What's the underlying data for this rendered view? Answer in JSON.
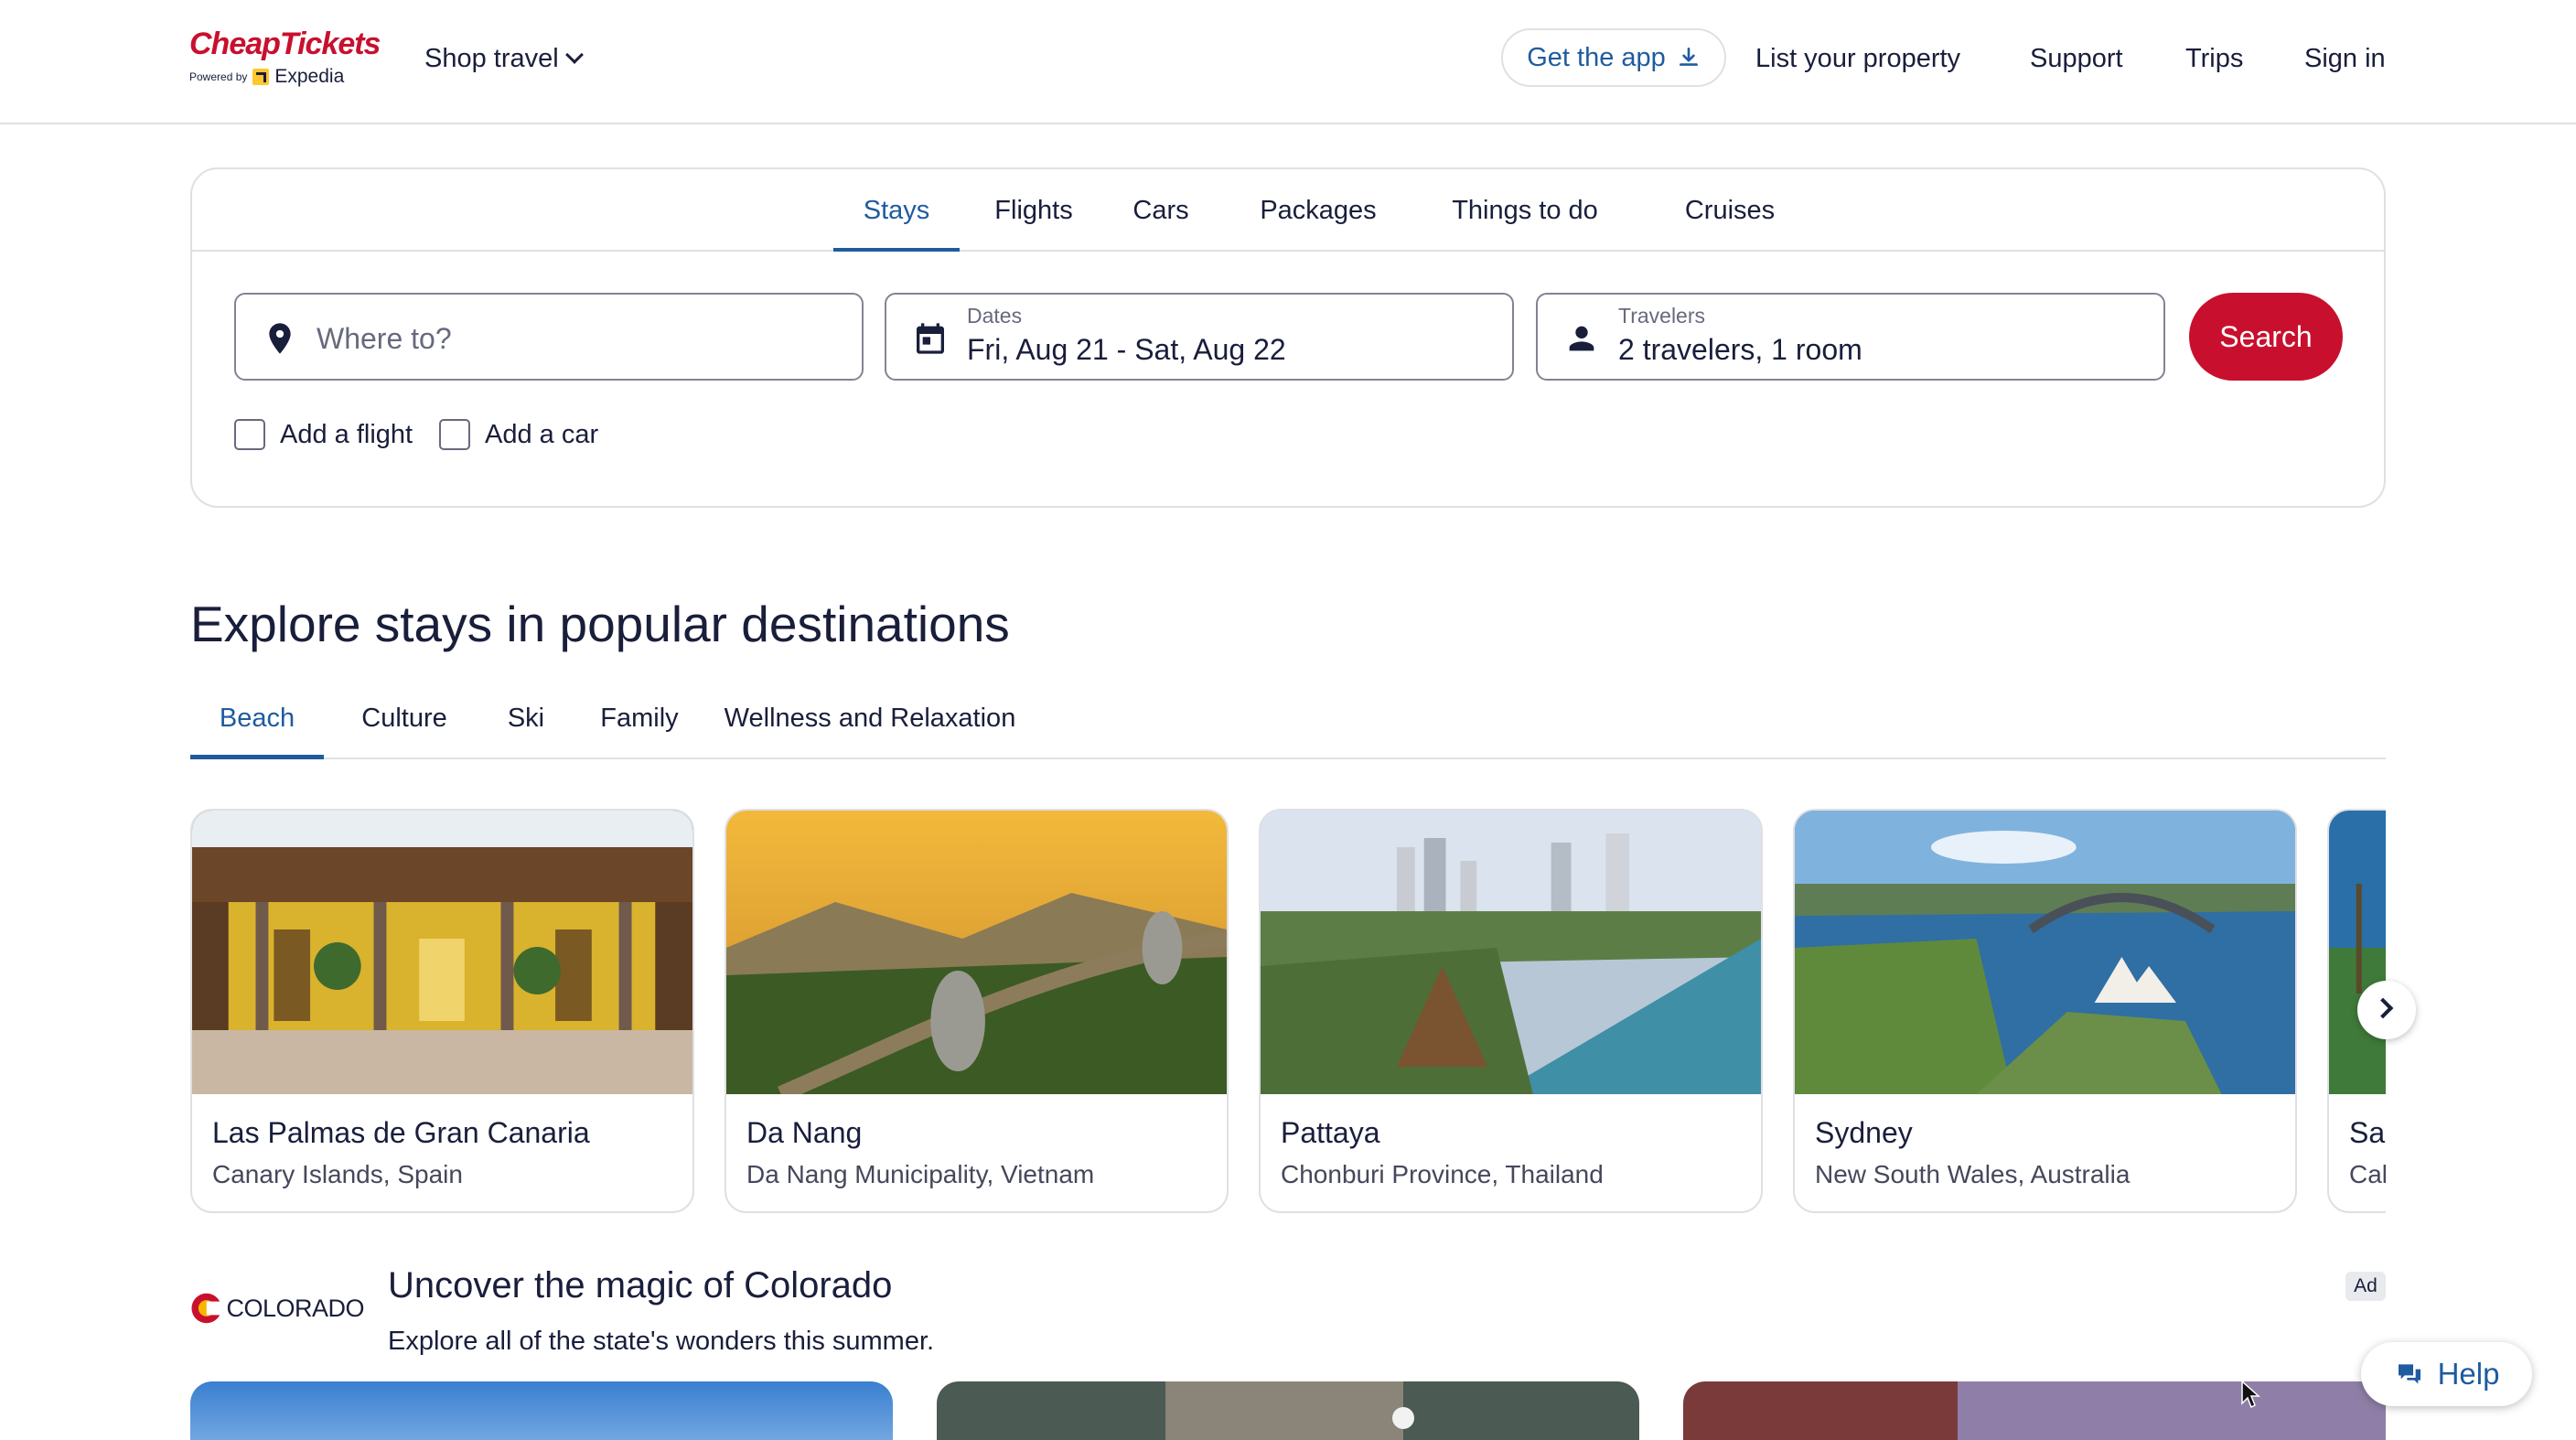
{
  "header": {
    "logo_text": "CheapTickets",
    "logo_powered": "Powered by",
    "logo_partner": "Expedia",
    "shop_travel": "Shop travel",
    "get_app": "Get the app",
    "list_property": "List your property",
    "support": "Support",
    "trips": "Trips",
    "sign_in": "Sign in"
  },
  "search": {
    "tabs": [
      {
        "label": "Stays",
        "active": true
      },
      {
        "label": "Flights",
        "active": false
      },
      {
        "label": "Cars",
        "active": false
      },
      {
        "label": "Packages",
        "active": false
      },
      {
        "label": "Things to do",
        "active": false
      },
      {
        "label": "Cruises",
        "active": false
      }
    ],
    "where_placeholder": "Where to?",
    "dates_label": "Dates",
    "dates_value": "Fri, Aug 21 - Sat, Aug 22",
    "travelers_label": "Travelers",
    "travelers_value": "2 travelers, 1 room",
    "search_button": "Search",
    "add_flight": "Add a flight",
    "add_car": "Add a car"
  },
  "explore": {
    "title": "Explore stays in popular destinations",
    "categories": [
      {
        "label": "Beach",
        "active": true
      },
      {
        "label": "Culture",
        "active": false
      },
      {
        "label": "Ski",
        "active": false
      },
      {
        "label": "Family",
        "active": false
      },
      {
        "label": "Wellness and Relaxation",
        "active": false
      }
    ],
    "destinations": [
      {
        "name": "Las Palmas de Gran Canaria",
        "region": "Canary Islands, Spain"
      },
      {
        "name": "Da Nang",
        "region": "Da Nang Municipality, Vietnam"
      },
      {
        "name": "Pattaya",
        "region": "Chonburi Province, Thailand"
      },
      {
        "name": "Sydney",
        "region": "New South Wales, Australia"
      },
      {
        "name": "Sa",
        "region": "Cal"
      }
    ]
  },
  "ad": {
    "brand": "COLORADO",
    "title": "Uncover the magic of Colorado",
    "subtitle": "Explore all of the state's wonders this summer.",
    "badge": "Ad"
  },
  "help": {
    "label": "Help"
  },
  "colors": {
    "brand_red": "#c8102e",
    "link_blue": "#1f5b9f",
    "text": "#191e3b",
    "border": "#dfe0e4"
  }
}
